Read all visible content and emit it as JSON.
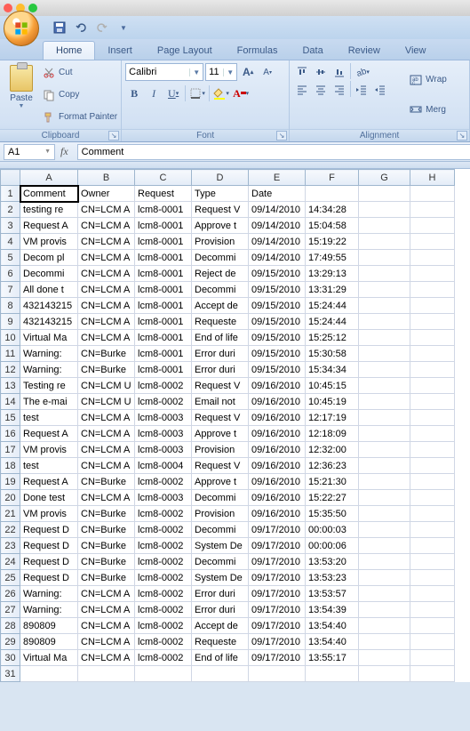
{
  "titlebar": {},
  "qat": {
    "save": "save-icon",
    "undo": "undo-icon",
    "redo": "redo-icon"
  },
  "tabs": [
    "Home",
    "Insert",
    "Page Layout",
    "Formulas",
    "Data",
    "Review",
    "View"
  ],
  "active_tab": 0,
  "clipboard": {
    "paste": "Paste",
    "cut": "Cut",
    "copy": "Copy",
    "fmt": "Format Painter",
    "label": "Clipboard"
  },
  "font": {
    "name": "Calibri",
    "size": "11",
    "label": "Font",
    "grow": "A",
    "shrink": "A",
    "bold": "B",
    "italic": "I",
    "underline": "U"
  },
  "alignment": {
    "label": "Alignment",
    "wrap": "Wrap",
    "merge": "Merg"
  },
  "name_box": "A1",
  "formula": "Comment",
  "columns": [
    "A",
    "B",
    "C",
    "D",
    "E",
    "F",
    "G",
    "H"
  ],
  "headers": [
    "Comment",
    "Owner",
    "Request",
    "Type",
    "Date",
    "",
    "",
    ""
  ],
  "rows": [
    {
      "n": 1,
      "cells": [
        "Comment",
        "Owner",
        "Request",
        "Type",
        "Date",
        "",
        "",
        ""
      ]
    },
    {
      "n": 2,
      "cells": [
        "testing re",
        "CN=LCM A",
        "lcm8-0001",
        "Request V",
        "09/14/2010",
        "14:34:28",
        "",
        ""
      ]
    },
    {
      "n": 3,
      "cells": [
        "Request A",
        "CN=LCM A",
        "lcm8-0001",
        "Approve t",
        "09/14/2010",
        "15:04:58",
        "",
        ""
      ]
    },
    {
      "n": 4,
      "cells": [
        "VM provis",
        "CN=LCM A",
        "lcm8-0001",
        "Provision",
        "09/14/2010",
        "15:19:22",
        "",
        ""
      ]
    },
    {
      "n": 5,
      "cells": [
        "Decom pl",
        "CN=LCM A",
        "lcm8-0001",
        "Decommi",
        "09/14/2010",
        "17:49:55",
        "",
        ""
      ]
    },
    {
      "n": 6,
      "cells": [
        "Decommi",
        "CN=LCM A",
        "lcm8-0001",
        "Reject de",
        "09/15/2010",
        "13:29:13",
        "",
        ""
      ]
    },
    {
      "n": 7,
      "cells": [
        "All done t",
        "CN=LCM A",
        "lcm8-0001",
        "Decommi",
        "09/15/2010",
        "13:31:29",
        "",
        ""
      ]
    },
    {
      "n": 8,
      "cells": [
        "432143215",
        "CN=LCM A",
        "lcm8-0001",
        "Accept de",
        "09/15/2010",
        "15:24:44",
        "",
        ""
      ]
    },
    {
      "n": 9,
      "cells": [
        "432143215",
        "CN=LCM A",
        "lcm8-0001",
        "Requeste",
        "09/15/2010",
        "15:24:44",
        "",
        ""
      ]
    },
    {
      "n": 10,
      "cells": [
        "Virtual Ma",
        "CN=LCM A",
        "lcm8-0001",
        "End of life",
        "09/15/2010",
        "15:25:12",
        "",
        ""
      ]
    },
    {
      "n": 11,
      "cells": [
        "Warning: ",
        "CN=Burke",
        "lcm8-0001",
        "Error duri",
        "09/15/2010",
        "15:30:58",
        "",
        ""
      ]
    },
    {
      "n": 12,
      "cells": [
        "Warning: ",
        "CN=Burke",
        "lcm8-0001",
        "Error duri",
        "09/15/2010",
        "15:34:34",
        "",
        ""
      ]
    },
    {
      "n": 13,
      "cells": [
        "Testing re",
        "CN=LCM U",
        "lcm8-0002",
        "Request V",
        "09/16/2010",
        "10:45:15",
        "",
        ""
      ]
    },
    {
      "n": 14,
      "cells": [
        "The e-mai",
        "CN=LCM U",
        "lcm8-0002",
        "Email not",
        "09/16/2010",
        "10:45:19",
        "",
        ""
      ]
    },
    {
      "n": 15,
      "cells": [
        "test",
        "CN=LCM A",
        "lcm8-0003",
        "Request V",
        "09/16/2010",
        "12:17:19",
        "",
        ""
      ]
    },
    {
      "n": 16,
      "cells": [
        "Request A",
        "CN=LCM A",
        "lcm8-0003",
        "Approve t",
        "09/16/2010",
        "12:18:09",
        "",
        ""
      ]
    },
    {
      "n": 17,
      "cells": [
        "VM provis",
        "CN=LCM A",
        "lcm8-0003",
        "Provision",
        "09/16/2010",
        "12:32:00",
        "",
        ""
      ]
    },
    {
      "n": 18,
      "cells": [
        "test",
        "CN=LCM A",
        "lcm8-0004",
        "Request V",
        "09/16/2010",
        "12:36:23",
        "",
        ""
      ]
    },
    {
      "n": 19,
      "cells": [
        "Request A",
        "CN=Burke",
        "lcm8-0002",
        "Approve t",
        "09/16/2010",
        "15:21:30",
        "",
        ""
      ]
    },
    {
      "n": 20,
      "cells": [
        "Done test",
        "CN=LCM A",
        "lcm8-0003",
        "Decommi",
        "09/16/2010",
        "15:22:27",
        "",
        ""
      ]
    },
    {
      "n": 21,
      "cells": [
        "VM provis",
        "CN=Burke",
        "lcm8-0002",
        "Provision",
        "09/16/2010",
        "15:35:50",
        "",
        ""
      ]
    },
    {
      "n": 22,
      "cells": [
        "Request D",
        "CN=Burke",
        "lcm8-0002",
        "Decommi",
        "09/17/2010",
        "00:00:03",
        "",
        ""
      ]
    },
    {
      "n": 23,
      "cells": [
        "Request D",
        "CN=Burke",
        "lcm8-0002",
        "System De",
        "09/17/2010",
        "00:00:06",
        "",
        ""
      ]
    },
    {
      "n": 24,
      "cells": [
        "Request D",
        "CN=Burke",
        "lcm8-0002",
        "Decommi",
        "09/17/2010",
        "13:53:20",
        "",
        ""
      ]
    },
    {
      "n": 25,
      "cells": [
        "Request D",
        "CN=Burke",
        "lcm8-0002",
        "System De",
        "09/17/2010",
        "13:53:23",
        "",
        ""
      ]
    },
    {
      "n": 26,
      "cells": [
        "Warning: ",
        "CN=LCM A",
        "lcm8-0002",
        "Error duri",
        "09/17/2010",
        "13:53:57",
        "",
        ""
      ]
    },
    {
      "n": 27,
      "cells": [
        "Warning: ",
        "CN=LCM A",
        "lcm8-0002",
        "Error duri",
        "09/17/2010",
        "13:54:39",
        "",
        ""
      ]
    },
    {
      "n": 28,
      "cells": [
        "890809",
        "CN=LCM A",
        "lcm8-0002",
        "Accept de",
        "09/17/2010",
        "13:54:40",
        "",
        ""
      ]
    },
    {
      "n": 29,
      "cells": [
        "890809",
        "CN=LCM A",
        "lcm8-0002",
        "Requeste",
        "09/17/2010",
        "13:54:40",
        "",
        ""
      ]
    },
    {
      "n": 30,
      "cells": [
        "Virtual Ma",
        "CN=LCM A",
        "lcm8-0002",
        "End of life",
        "09/17/2010",
        "13:55:17",
        "",
        ""
      ]
    },
    {
      "n": 31,
      "cells": [
        "",
        "",
        "",
        "",
        "",
        "",
        "",
        ""
      ]
    }
  ]
}
